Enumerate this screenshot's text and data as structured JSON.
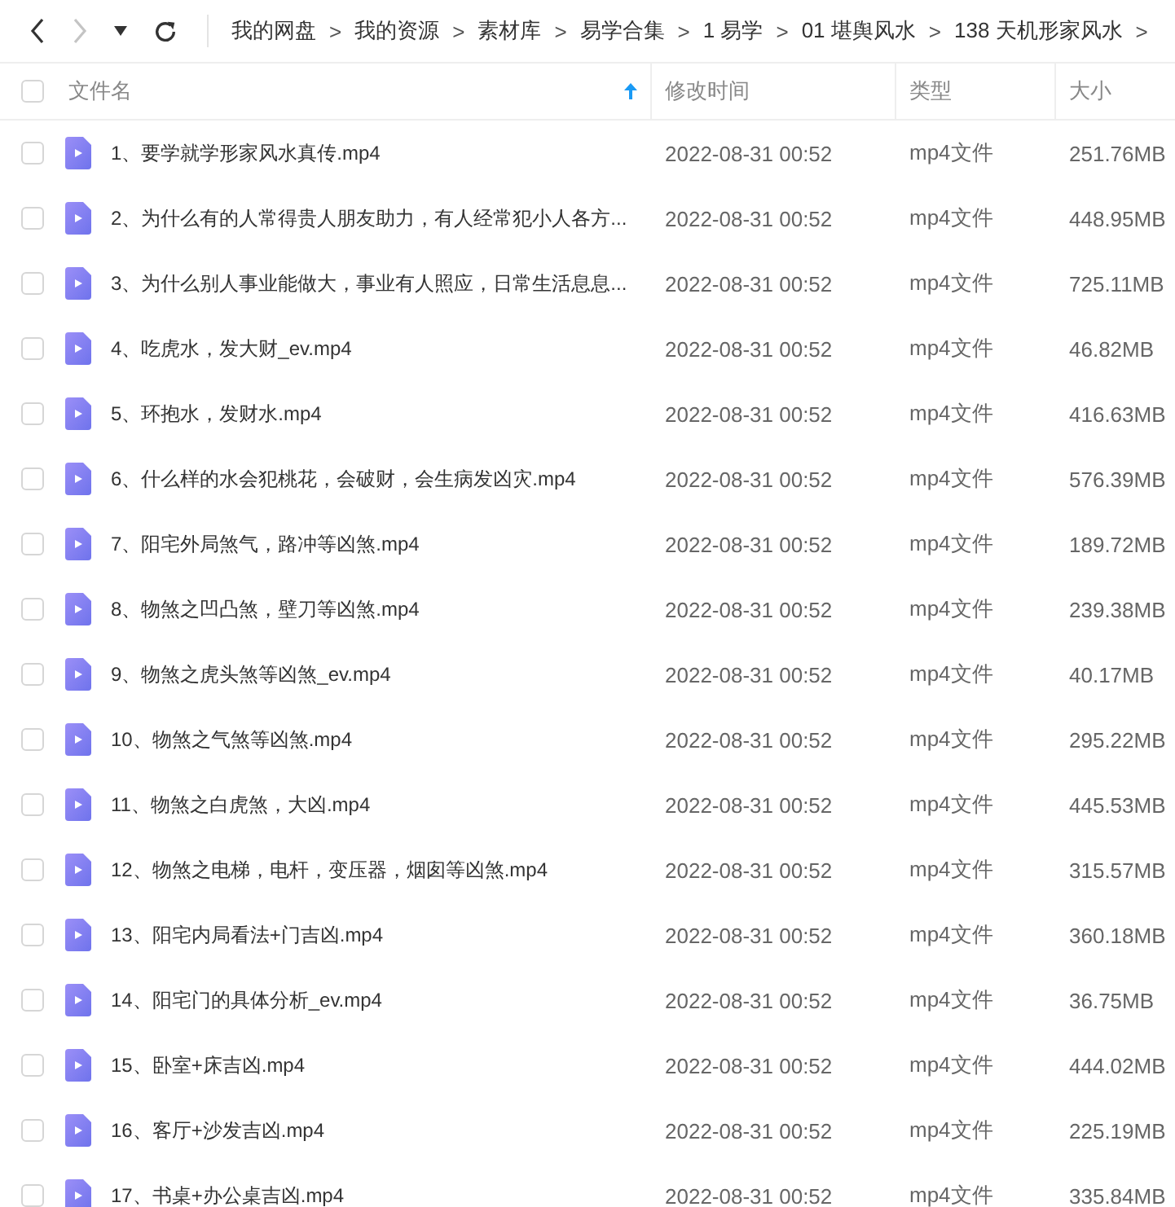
{
  "toolbar": {
    "nav": [
      {
        "kind": "back",
        "disabled": false
      },
      {
        "kind": "forward",
        "disabled": true
      },
      {
        "kind": "history",
        "disabled": false
      },
      {
        "kind": "refresh",
        "disabled": false
      }
    ],
    "breadcrumb": [
      {
        "label": "我的网盘",
        "sep": ">"
      },
      {
        "label": "我的资源",
        "sep": ">"
      },
      {
        "label": "素材库",
        "sep": ">"
      },
      {
        "label": "易学合集",
        "sep": ">"
      },
      {
        "label": "1 易学",
        "sep": ">"
      },
      {
        "label": "01 堪舆风水",
        "sep": ">"
      },
      {
        "label": "138 天机形家风水",
        "sep": ">"
      }
    ]
  },
  "table": {
    "select_all": {
      "checked": false
    },
    "columns": [
      {
        "label": "文件名",
        "sorted": true
      },
      {
        "label": "修改时间"
      },
      {
        "label": "类型"
      },
      {
        "label": "大小"
      }
    ],
    "rows": [
      {
        "name": "1、要学就学形家风水真传.mp4",
        "modified": "2022-08-31 00:52",
        "type": "mp4文件",
        "size": "251.76MB",
        "checked": false
      },
      {
        "name": "2、为什么有的人常得贵人朋友助力，有人经常犯小人各方...",
        "modified": "2022-08-31 00:52",
        "type": "mp4文件",
        "size": "448.95MB",
        "checked": false
      },
      {
        "name": "3、为什么别人事业能做大，事业有人照应，日常生活息息...",
        "modified": "2022-08-31 00:52",
        "type": "mp4文件",
        "size": "725.11MB",
        "checked": false
      },
      {
        "name": "4、吃虎水，发大财_ev.mp4",
        "modified": "2022-08-31 00:52",
        "type": "mp4文件",
        "size": "46.82MB",
        "checked": false
      },
      {
        "name": "5、环抱水，发财水.mp4",
        "modified": "2022-08-31 00:52",
        "type": "mp4文件",
        "size": "416.63MB",
        "checked": false
      },
      {
        "name": "6、什么样的水会犯桃花，会破财，会生病发凶灾.mp4",
        "modified": "2022-08-31 00:52",
        "type": "mp4文件",
        "size": "576.39MB",
        "checked": false
      },
      {
        "name": "7、阳宅外局煞气，路冲等凶煞.mp4",
        "modified": "2022-08-31 00:52",
        "type": "mp4文件",
        "size": "189.72MB",
        "checked": false
      },
      {
        "name": "8、物煞之凹凸煞，壁刀等凶煞.mp4",
        "modified": "2022-08-31 00:52",
        "type": "mp4文件",
        "size": "239.38MB",
        "checked": false
      },
      {
        "name": "9、物煞之虎头煞等凶煞_ev.mp4",
        "modified": "2022-08-31 00:52",
        "type": "mp4文件",
        "size": "40.17MB",
        "checked": false
      },
      {
        "name": "10、物煞之气煞等凶煞.mp4",
        "modified": "2022-08-31 00:52",
        "type": "mp4文件",
        "size": "295.22MB",
        "checked": false
      },
      {
        "name": "11、物煞之白虎煞，大凶.mp4",
        "modified": "2022-08-31 00:52",
        "type": "mp4文件",
        "size": "445.53MB",
        "checked": false
      },
      {
        "name": "12、物煞之电梯，电杆，变压器，烟囱等凶煞.mp4",
        "modified": "2022-08-31 00:52",
        "type": "mp4文件",
        "size": "315.57MB",
        "checked": false
      },
      {
        "name": "13、阳宅内局看法+门吉凶.mp4",
        "modified": "2022-08-31 00:52",
        "type": "mp4文件",
        "size": "360.18MB",
        "checked": false
      },
      {
        "name": "14、阳宅门的具体分析_ev.mp4",
        "modified": "2022-08-31 00:52",
        "type": "mp4文件",
        "size": "36.75MB",
        "checked": false
      },
      {
        "name": "15、卧室+床吉凶.mp4",
        "modified": "2022-08-31 00:52",
        "type": "mp4文件",
        "size": "444.02MB",
        "checked": false
      },
      {
        "name": "16、客厅+沙发吉凶.mp4",
        "modified": "2022-08-31 00:52",
        "type": "mp4文件",
        "size": "225.19MB",
        "checked": false
      },
      {
        "name": "17、书桌+办公桌吉凶.mp4",
        "modified": "2022-08-31 00:52",
        "type": "mp4文件",
        "size": "335.84MB",
        "checked": false
      }
    ]
  }
}
